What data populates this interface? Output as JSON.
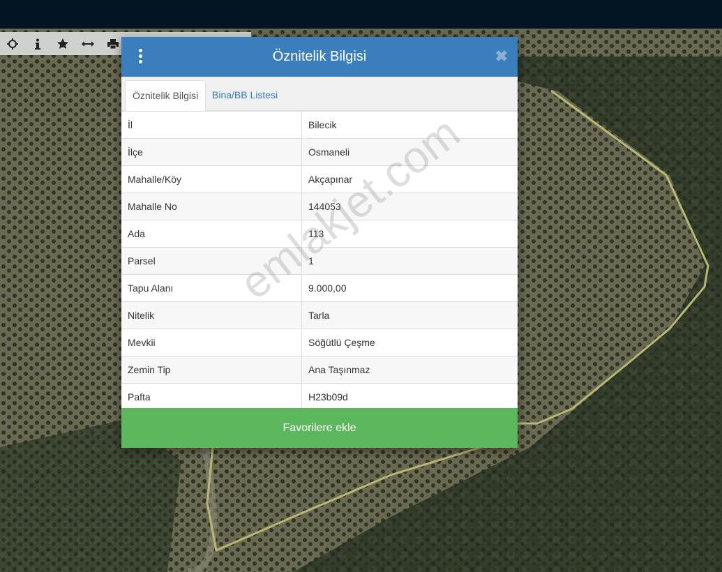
{
  "map_toolbar": {
    "buttons": [
      {
        "icon": "crosshair-icon"
      },
      {
        "icon": "info-icon"
      },
      {
        "icon": "star-icon"
      },
      {
        "icon": "measure-arrows-icon"
      },
      {
        "icon": "print-icon"
      }
    ]
  },
  "modal": {
    "title": "Öznitelik Bilgisi",
    "tabs": [
      {
        "label": "Öznitelik Bilgisi",
        "active": true
      },
      {
        "label": "Bina/BB Listesi",
        "active": false
      }
    ],
    "rows": [
      {
        "key": "İl",
        "value": "Bilecik"
      },
      {
        "key": "İlçe",
        "value": "Osmaneli"
      },
      {
        "key": "Mahalle/Köy",
        "value": "Akçapınar"
      },
      {
        "key": "Mahalle No",
        "value": "144053"
      },
      {
        "key": "Ada",
        "value": "113"
      },
      {
        "key": "Parsel",
        "value": "1"
      },
      {
        "key": "Tapu Alanı",
        "value": "9.000,00"
      },
      {
        "key": "Nitelik",
        "value": "Tarla"
      },
      {
        "key": "Mevkii",
        "value": "Söğütlü Çeşme"
      },
      {
        "key": "Zemin Tip",
        "value": "Ana Taşınmaz"
      },
      {
        "key": "Pafta",
        "value": "H23b09d"
      }
    ],
    "favorite_button": "Favorilere ekle"
  },
  "watermark": "emlakjet.com",
  "colors": {
    "header": "#3a7ebe",
    "favorite": "#5cb85c",
    "topbar": "#031423",
    "parcel_outline": "#b9b873"
  }
}
